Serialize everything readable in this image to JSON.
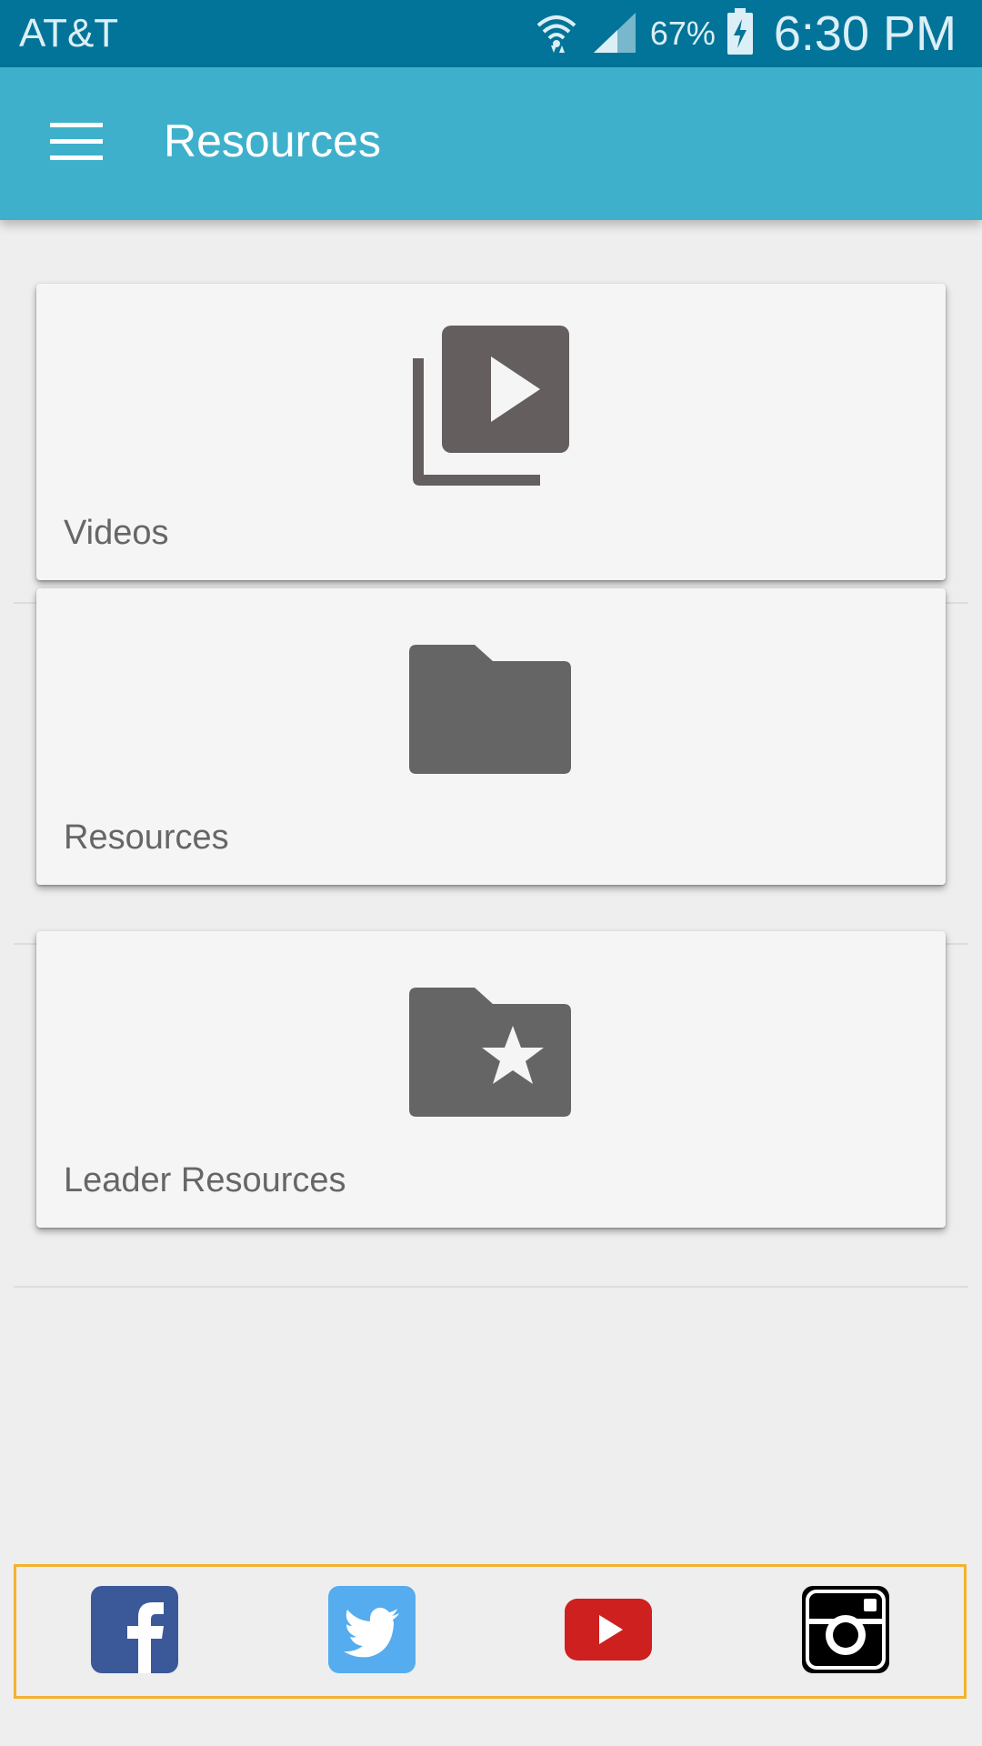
{
  "status_bar": {
    "carrier": "AT&T",
    "battery": "67%",
    "time": "6:30 PM"
  },
  "app_bar": {
    "title": "Resources",
    "menu_icon": "hamburger-menu-icon",
    "color": "#3fb0cb"
  },
  "cards": [
    {
      "label": "Videos",
      "icon": "video-library-icon"
    },
    {
      "label": "Resources",
      "icon": "folder-icon"
    },
    {
      "label": "Leader Resources",
      "icon": "folder-star-icon"
    }
  ],
  "social": [
    {
      "name": "facebook",
      "icon": "facebook-icon",
      "color": "#3b5998"
    },
    {
      "name": "twitter",
      "icon": "twitter-icon",
      "color": "#55acee"
    },
    {
      "name": "youtube",
      "icon": "youtube-icon",
      "color": "#cd201f"
    },
    {
      "name": "instagram",
      "icon": "instagram-icon",
      "color": "#000000"
    }
  ],
  "colors": {
    "status_bar": "#027499",
    "icon_gray": "#666666",
    "social_border": "#f3b22f"
  }
}
